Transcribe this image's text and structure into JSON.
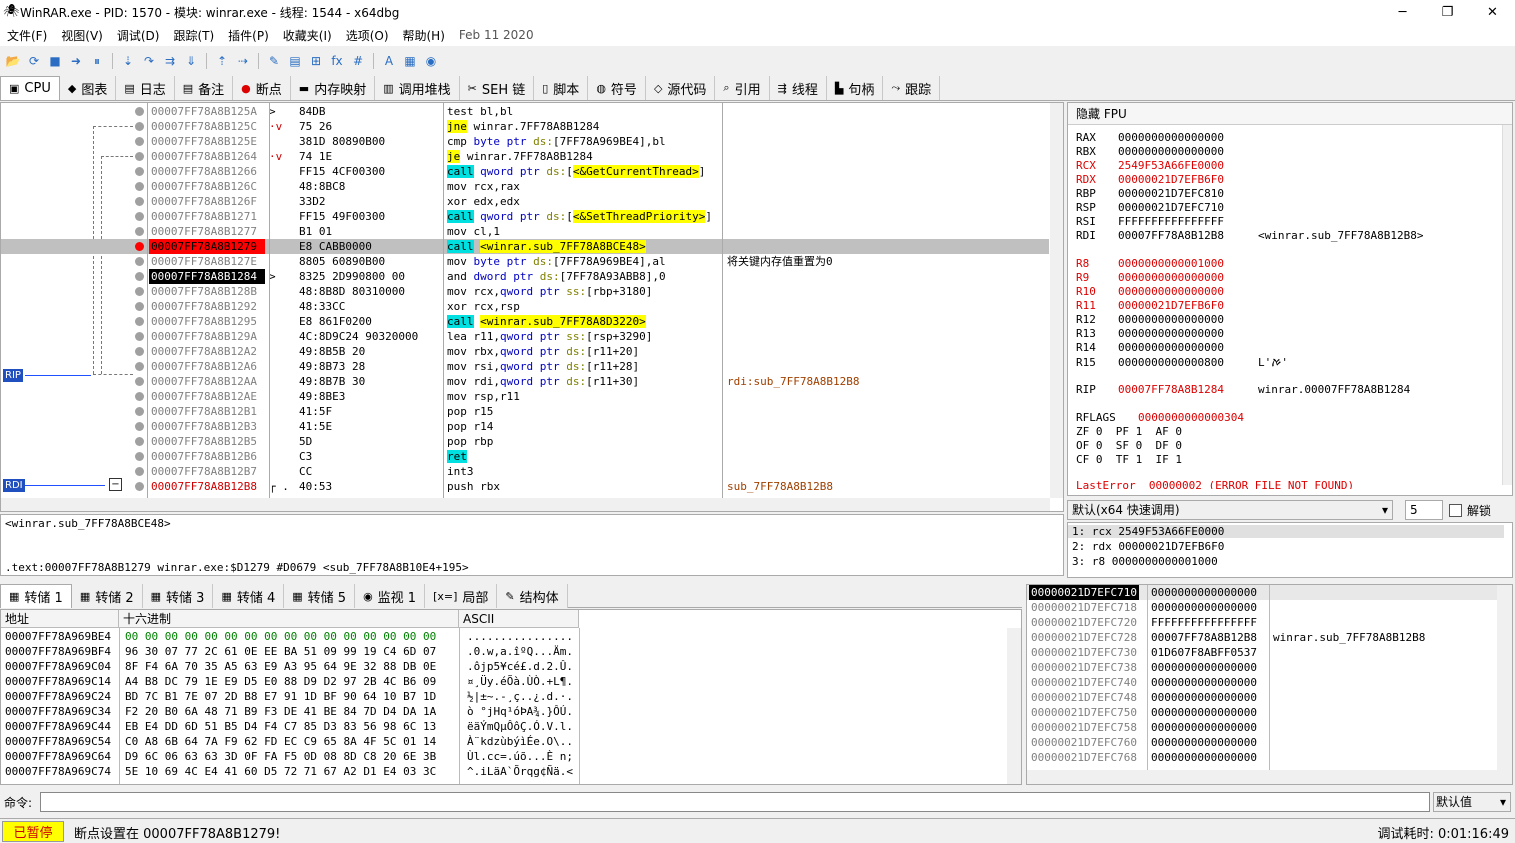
{
  "window": {
    "title": "WinRAR.exe - PID: 1570 - 模块: winrar.exe - 线程: 1544 - x64dbg"
  },
  "menu": [
    "文件(F)",
    "视图(V)",
    "调试(D)",
    "跟踪(T)",
    "插件(P)",
    "收藏夹(I)",
    "选项(O)",
    "帮助(H)"
  ],
  "menu_date": "Feb 11 2020",
  "tabs": [
    "CPU",
    "图表",
    "日志",
    "备注",
    "断点",
    "内存映射",
    "调用堆栈",
    "SEH 链",
    "脚本",
    "符号",
    "源代码",
    "引用",
    "线程",
    "句柄",
    "跟踪"
  ],
  "labels": {
    "rip": "RIP",
    "rdi": "RDI"
  },
  "disasm": [
    {
      "addr": "00007FF78A8B125A",
      "mark": ">",
      "bytes": "84DB",
      "ins": "test bl,bl",
      "cmt": ""
    },
    {
      "addr": "00007FF78A8B125C",
      "mark": "·v",
      "bytes": "75 26",
      "ins": "jne winrar.7FF78A8B1284",
      "cmt": ""
    },
    {
      "addr": "00007FF78A8B125E",
      "mark": "",
      "bytes": "381D 80890B00",
      "ins": "cmp byte ptr ds:[7FF78A969BE4],bl",
      "cmt": ""
    },
    {
      "addr": "00007FF78A8B1264",
      "mark": "·v",
      "bytes": "74 1E",
      "ins": "je winrar.7FF78A8B1284",
      "cmt": ""
    },
    {
      "addr": "00007FF78A8B1266",
      "mark": "",
      "bytes": "FF15 4CF00300",
      "ins": "call qword ptr ds:[<&GetCurrentThread>]",
      "cmt": ""
    },
    {
      "addr": "00007FF78A8B126C",
      "mark": "",
      "bytes": "48:8BC8",
      "ins": "mov rcx,rax",
      "cmt": ""
    },
    {
      "addr": "00007FF78A8B126F",
      "mark": "",
      "bytes": "33D2",
      "ins": "xor edx,edx",
      "cmt": ""
    },
    {
      "addr": "00007FF78A8B1271",
      "mark": "",
      "bytes": "FF15 49F00300",
      "ins": "call qword ptr ds:[<&SetThreadPriority>]",
      "cmt": ""
    },
    {
      "addr": "00007FF78A8B1277",
      "mark": "",
      "bytes": "B1 01",
      "ins": "mov cl,1",
      "cmt": ""
    },
    {
      "addr": "00007FF78A8B1279",
      "mark": "",
      "bytes": "E8 CABB0000",
      "ins": "call <winrar.sub_7FF78A8BCE48>",
      "cmt": ""
    },
    {
      "addr": "00007FF78A8B127E",
      "mark": "",
      "bytes": "8805 60890B00",
      "ins": "mov byte ptr ds:[7FF78A969BE4],al",
      "cmt": "将关键内存值重置为0"
    },
    {
      "addr": "00007FF78A8B1284",
      "mark": ">",
      "bytes": "8325 2D990800 00",
      "ins": "and dword ptr ds:[7FF78A93ABB8],0",
      "cmt": ""
    },
    {
      "addr": "00007FF78A8B128B",
      "mark": "",
      "bytes": "48:8B8D 80310000",
      "ins": "mov rcx,qword ptr ss:[rbp+3180]",
      "cmt": ""
    },
    {
      "addr": "00007FF78A8B1292",
      "mark": "",
      "bytes": "48:33CC",
      "ins": "xor rcx,rsp",
      "cmt": ""
    },
    {
      "addr": "00007FF78A8B1295",
      "mark": "",
      "bytes": "E8 861F0200",
      "ins": "call <winrar.sub_7FF78A8D3220>",
      "cmt": ""
    },
    {
      "addr": "00007FF78A8B129A",
      "mark": "",
      "bytes": "4C:8D9C24 90320000",
      "ins": "lea r11,qword ptr ss:[rsp+3290]",
      "cmt": ""
    },
    {
      "addr": "00007FF78A8B12A2",
      "mark": "",
      "bytes": "49:8B5B 20",
      "ins": "mov rbx,qword ptr ds:[r11+20]",
      "cmt": ""
    },
    {
      "addr": "00007FF78A8B12A6",
      "mark": "",
      "bytes": "49:8B73 28",
      "ins": "mov rsi,qword ptr ds:[r11+28]",
      "cmt": ""
    },
    {
      "addr": "00007FF78A8B12AA",
      "mark": "",
      "bytes": "49:8B7B 30",
      "ins": "mov rdi,qword ptr ds:[r11+30]",
      "cmt": "rdi:sub_7FF78A8B12B8"
    },
    {
      "addr": "00007FF78A8B12AE",
      "mark": "",
      "bytes": "49:8BE3",
      "ins": "mov rsp,r11",
      "cmt": ""
    },
    {
      "addr": "00007FF78A8B12B1",
      "mark": "",
      "bytes": "41:5F",
      "ins": "pop r15",
      "cmt": ""
    },
    {
      "addr": "00007FF78A8B12B3",
      "mark": "",
      "bytes": "41:5E",
      "ins": "pop r14",
      "cmt": ""
    },
    {
      "addr": "00007FF78A8B12B5",
      "mark": "",
      "bytes": "5D",
      "ins": "pop rbp",
      "cmt": ""
    },
    {
      "addr": "00007FF78A8B12B6",
      "mark": "",
      "bytes": "C3",
      "ins": "ret",
      "cmt": ""
    },
    {
      "addr": "00007FF78A8B12B7",
      "mark": "",
      "bytes": "CC",
      "ins": "int3",
      "cmt": ""
    },
    {
      "addr": "00007FF78A8B12B8",
      "mark": "┌ .",
      "bytes": "40:53",
      "ins": "push rbx",
      "cmt": "sub_7FF78A8B12B8"
    }
  ],
  "info": {
    "line1": "<winrar.sub_7FF78A8BCE48>",
    "line2": ".text:00007FF78A8B1279 winrar.exe:$D1279 #D0679 <sub_7FF78A8B10E4+195>"
  },
  "regs_header": "隐藏 FPU",
  "regs": [
    {
      "n": "RAX",
      "v": "0000000000000000",
      "c": "",
      "red": false
    },
    {
      "n": "RBX",
      "v": "0000000000000000",
      "c": "",
      "red": false
    },
    {
      "n": "RCX",
      "v": "2549F53A66FE0000",
      "c": "",
      "red": true
    },
    {
      "n": "RDX",
      "v": "00000021D7EFB6F0",
      "c": "",
      "red": true
    },
    {
      "n": "RBP",
      "v": "00000021D7EFC810",
      "c": "",
      "red": false
    },
    {
      "n": "RSP",
      "v": "00000021D7EFC710",
      "c": "",
      "red": false
    },
    {
      "n": "RSI",
      "v": "FFFFFFFFFFFFFFFF",
      "c": "",
      "red": false
    },
    {
      "n": "RDI",
      "v": "00007FF78A8B12B8",
      "c": "<winrar.sub_7FF78A8B12B8>",
      "red": false
    },
    {
      "n": "R8",
      "v": "0000000000001000",
      "c": "",
      "red": true
    },
    {
      "n": "R9",
      "v": "0000000000000000",
      "c": "",
      "red": true
    },
    {
      "n": "R10",
      "v": "0000000000000000",
      "c": "",
      "red": true
    },
    {
      "n": "R11",
      "v": "00000021D7EFB6F0",
      "c": "",
      "red": true
    },
    {
      "n": "R12",
      "v": "0000000000000000",
      "c": "",
      "red": false
    },
    {
      "n": "R13",
      "v": "0000000000000000",
      "c": "",
      "red": false
    },
    {
      "n": "R14",
      "v": "0000000000000000",
      "c": "",
      "red": false
    },
    {
      "n": "R15",
      "v": "0000000000000800",
      "c": "L'ࠀ'",
      "red": false
    },
    {
      "n": "RIP",
      "v": "00007FF78A8B1284",
      "c": "winrar.00007FF78A8B1284",
      "red": true
    },
    {
      "n": "RFLAGS",
      "v": "0000000000000304",
      "c": "",
      "red": true
    }
  ],
  "flags": [
    "ZF 0  PF 1  AF 0",
    "OF 0  SF 0  DF 0",
    "CF 0  TF 1  IF 1"
  ],
  "lasterror": "LastError  00000002 (ERROR_FILE_NOT_FOUND)",
  "callconv": {
    "label": "默认(x64 快速调用)",
    "count": "5",
    "unlock": "解锁"
  },
  "stackargs": [
    "1: rcx 2549F53A66FE0000",
    "2: rdx 00000021D7EFB6F0",
    "3: r8 0000000000001000"
  ],
  "dump_tabs": [
    "转储 1",
    "转储 2",
    "转储 3",
    "转储 4",
    "转储 5",
    "监视 1",
    "局部",
    "结构体"
  ],
  "dump_headers": {
    "addr": "地址",
    "hex": "十六进制",
    "ascii": "ASCII"
  },
  "dump": [
    {
      "a": "00007FF78A969BE4",
      "h": "00 00 00 00 00 00 00 00 00 00 00 00 00 00 00 00",
      "s": "................"
    },
    {
      "a": "00007FF78A969BF4",
      "h": "96 30 07 77 2C 61 0E EE BA 51 09 99 19 C4 6D 07",
      "s": ".0.w,a.îºQ...Äm."
    },
    {
      "a": "00007FF78A969C04",
      "h": "8F F4 6A 70 35 A5 63 E9 A3 95 64 9E 32 88 DB 0E",
      "s": ".ôjp5¥cé£.d.2.Û."
    },
    {
      "a": "00007FF78A969C14",
      "h": "A4 B8 DC 79 1E E9 D5 E0 88 D9 D2 97 2B 4C B6 09",
      "s": "¤¸Üy.éÕà.ÙÒ.+L¶."
    },
    {
      "a": "00007FF78A969C24",
      "h": "BD 7C B1 7E 07 2D B8 E7 91 1D BF 90 64 10 B7 1D",
      "s": "½|±~.-¸ç..¿.d.·."
    },
    {
      "a": "00007FF78A969C34",
      "h": "F2 20 B0 6A 48 71 B9 F3 DE 41 BE 84 7D D4 DA 1A",
      "s": "ò °jHq¹óÞA¾.}ÔÚ."
    },
    {
      "a": "00007FF78A969C44",
      "h": "EB E4 DD 6D 51 B5 D4 F4 C7 85 D3 83 56 98 6C 13",
      "s": "ëäÝmQµÔôÇ.Ó.V.l."
    },
    {
      "a": "00007FF78A969C54",
      "h": "C0 A8 6B 64 7A F9 62 FD EC C9 65 8A 4F 5C 01 14",
      "s": "À¨kdzùbýìÉe.O\\.."
    },
    {
      "a": "00007FF78A969C64",
      "h": "D9 6C 06 63 63 3D 0F FA F5 0D 08 8D C8 20 6E 3B",
      "s": "Ùl.cc=.úõ...È n;"
    },
    {
      "a": "00007FF78A969C74",
      "h": "5E 10 69 4C E4 41 60 D5 72 71 67 A2 D1 E4 03 3C",
      "s": "^.iLäA`Õrqg¢Ñä.<"
    }
  ],
  "stack": [
    {
      "a": "00000021D7EFC710",
      "v": "0000000000000000",
      "c": ""
    },
    {
      "a": "00000021D7EFC718",
      "v": "0000000000000000",
      "c": ""
    },
    {
      "a": "00000021D7EFC720",
      "v": "FFFFFFFFFFFFFFFF",
      "c": ""
    },
    {
      "a": "00000021D7EFC728",
      "v": "00007FF78A8B12B8",
      "c": "winrar.sub_7FF78A8B12B8"
    },
    {
      "a": "00000021D7EFC730",
      "v": "01D607F8ABFF0537",
      "c": ""
    },
    {
      "a": "00000021D7EFC738",
      "v": "0000000000000000",
      "c": ""
    },
    {
      "a": "00000021D7EFC740",
      "v": "0000000000000000",
      "c": ""
    },
    {
      "a": "00000021D7EFC748",
      "v": "0000000000000000",
      "c": ""
    },
    {
      "a": "00000021D7EFC750",
      "v": "0000000000000000",
      "c": ""
    },
    {
      "a": "00000021D7EFC758",
      "v": "0000000000000000",
      "c": ""
    },
    {
      "a": "00000021D7EFC760",
      "v": "0000000000000000",
      "c": ""
    },
    {
      "a": "00000021D7EFC768",
      "v": "0000000000000000",
      "c": ""
    }
  ],
  "command": {
    "label": "命令:",
    "default": "默认值"
  },
  "status": {
    "state": "已暂停",
    "message": "断点设置在 00007FF78A8B1279!",
    "time": "调试耗时:  0:01:16:49"
  }
}
